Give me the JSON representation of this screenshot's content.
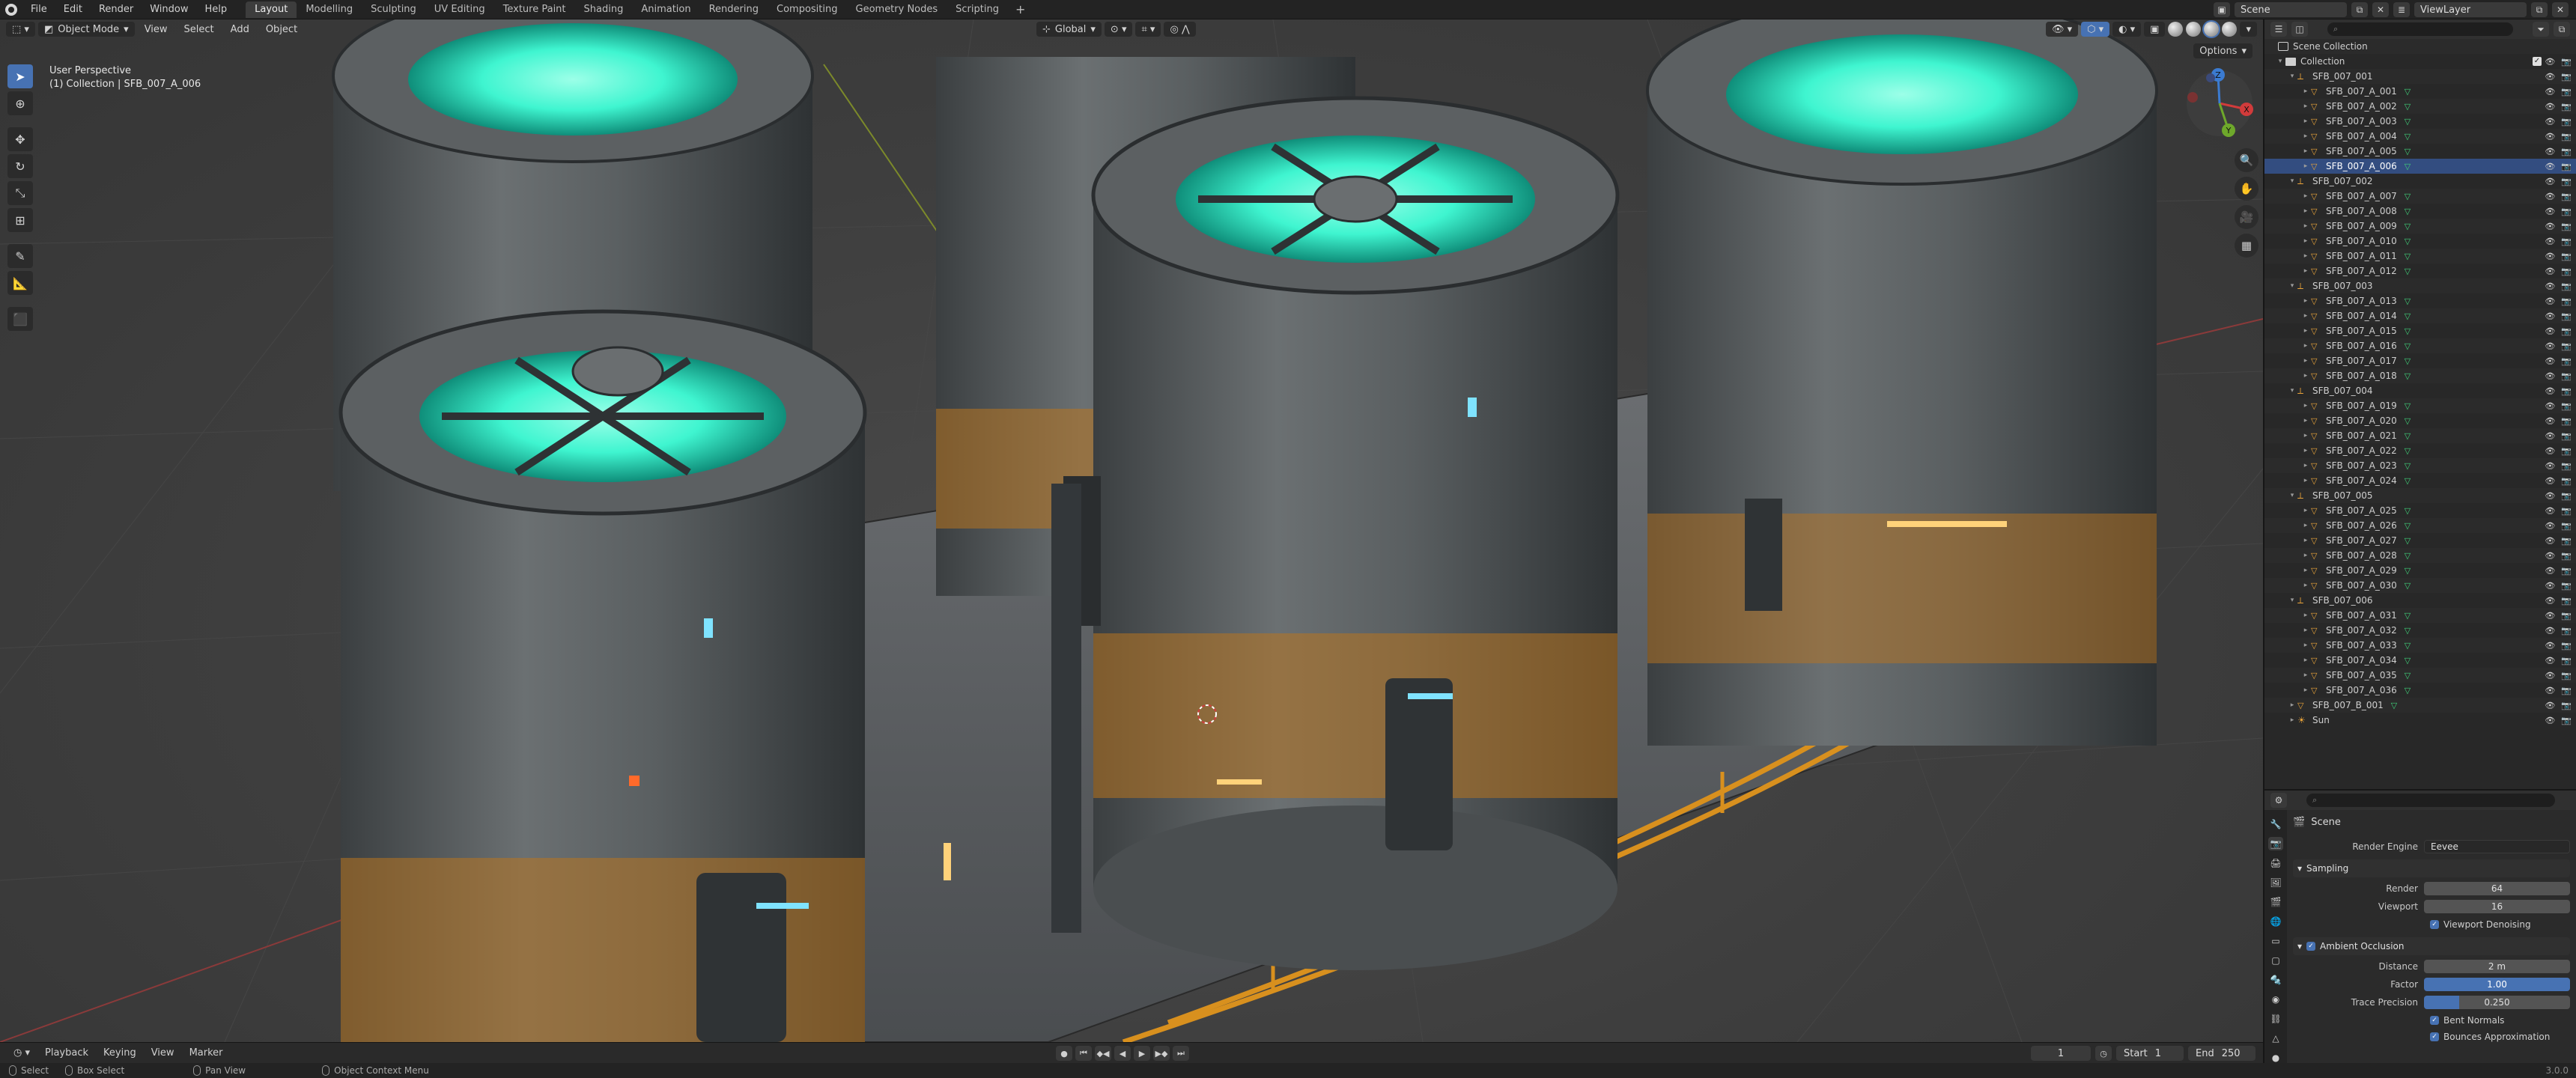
{
  "topbar": {
    "menus": [
      "File",
      "Edit",
      "Render",
      "Window",
      "Help"
    ],
    "workspaces": [
      "Layout",
      "Modelling",
      "Sculpting",
      "UV Editing",
      "Texture Paint",
      "Shading",
      "Animation",
      "Rendering",
      "Compositing",
      "Geometry Nodes",
      "Scripting"
    ],
    "active_workspace": "Layout",
    "scene": "Scene",
    "view_layer": "ViewLayer"
  },
  "viewport": {
    "mode": "Object Mode",
    "menus": [
      "View",
      "Select",
      "Add",
      "Object"
    ],
    "orientation": "Global",
    "options": "Options",
    "overlay_title": "User Perspective",
    "overlay_subtitle": "(1) Collection | SFB_007_A_006",
    "gizmo": {
      "x": "X",
      "y": "Y",
      "z": "Z"
    }
  },
  "timeline": {
    "menus": [
      "Playback",
      "Keying",
      "View",
      "Marker"
    ],
    "current_frame": "1",
    "start_label": "Start",
    "start": "1",
    "end_label": "End",
    "end": "250"
  },
  "statusbar": {
    "select": "Select",
    "box_select": "Box Select",
    "pan_view": "Pan View",
    "context_menu": "Object Context Menu",
    "version": "3.0.0"
  },
  "outliner": {
    "scene_collection": "Scene Collection",
    "collection": "Collection",
    "groups": [
      {
        "name": "SFB_007_001",
        "items": [
          "SFB_007_A_001",
          "SFB_007_A_002",
          "SFB_007_A_003",
          "SFB_007_A_004",
          "SFB_007_A_005",
          "SFB_007_A_006"
        ]
      },
      {
        "name": "SFB_007_002",
        "items": [
          "SFB_007_A_007",
          "SFB_007_A_008",
          "SFB_007_A_009",
          "SFB_007_A_010",
          "SFB_007_A_011",
          "SFB_007_A_012"
        ]
      },
      {
        "name": "SFB_007_003",
        "items": [
          "SFB_007_A_013",
          "SFB_007_A_014",
          "SFB_007_A_015",
          "SFB_007_A_016",
          "SFB_007_A_017",
          "SFB_007_A_018"
        ]
      },
      {
        "name": "SFB_007_004",
        "items": [
          "SFB_007_A_019",
          "SFB_007_A_020",
          "SFB_007_A_021",
          "SFB_007_A_022",
          "SFB_007_A_023",
          "SFB_007_A_024"
        ]
      },
      {
        "name": "SFB_007_005",
        "items": [
          "SFB_007_A_025",
          "SFB_007_A_026",
          "SFB_007_A_027",
          "SFB_007_A_028",
          "SFB_007_A_029",
          "SFB_007_A_030"
        ]
      },
      {
        "name": "SFB_007_006",
        "items": [
          "SFB_007_A_031",
          "SFB_007_A_032",
          "SFB_007_A_033",
          "SFB_007_A_034",
          "SFB_007_A_035",
          "SFB_007_A_036"
        ]
      }
    ],
    "extra_object": "SFB_007_B_001",
    "sun": "Sun",
    "selected": "SFB_007_A_006"
  },
  "properties": {
    "scene": "Scene",
    "render_engine_label": "Render Engine",
    "render_engine": "Eevee",
    "sampling": {
      "title": "Sampling",
      "render_label": "Render",
      "render": "64",
      "viewport_label": "Viewport",
      "viewport": "16",
      "denoise": "Viewport Denoising"
    },
    "ao": {
      "title": "Ambient Occlusion",
      "distance_label": "Distance",
      "distance": "2 m",
      "factor_label": "Factor",
      "factor": "1.00",
      "trace_label": "Trace Precision",
      "trace": "0.250",
      "bent_normals": "Bent Normals",
      "bounces": "Bounces Approximation"
    }
  },
  "colors": {
    "accent": "#4772b3",
    "selected_row": "#334d80",
    "glow": "#3ff5d0",
    "hazard": "#d8901e",
    "mesh": "#3fd17a",
    "empty": "#e8a33a"
  }
}
